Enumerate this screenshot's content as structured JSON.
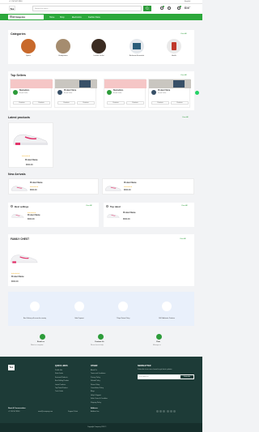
{
  "topbar": {
    "left_text": "+1 234 567 8900",
    "right_text": "English"
  },
  "header": {
    "logo": "Tex",
    "search_placeholder": "Search for items...",
    "cart_label": "My Cart",
    "cart_total": "$0.00",
    "wishlist_count": "0",
    "cart_count": "0"
  },
  "nav": {
    "categories_label": "All Categories",
    "links": [
      "Home",
      "Shop",
      "Electronics",
      "Fashion Store"
    ]
  },
  "categories": {
    "title": "Categories",
    "view_all": "View All",
    "items": [
      "Sports",
      "Headphones",
      "Leather Jacket",
      "Bathroom Essentials",
      "Health"
    ]
  },
  "top_sellers": {
    "title": "Top Sellers",
    "view_all": "View All",
    "cards": [
      {
        "name": "Bestsellers",
        "sub": "Brand Seller",
        "btn": "Products"
      },
      {
        "name": "Product Store",
        "sub": "Brand Seller",
        "btn": "Products"
      },
      {
        "name": "Bestsellers",
        "sub": "Brand Seller",
        "btn": "Products"
      },
      {
        "name": "Product Store",
        "sub": "Brand Seller",
        "btn": "Products"
      }
    ]
  },
  "latest_products": {
    "title": "Latest products",
    "view_all": "View All",
    "product": {
      "name": "Product Name",
      "price": "$500.00",
      "stars": "★★★★★"
    }
  },
  "new_arrivals": {
    "title": "New Arrivals",
    "items": [
      {
        "name": "Product Name",
        "price": "$500.00",
        "btn": "Add to Cart"
      },
      {
        "name": "Product Name",
        "price": "$500.00",
        "btn": "Add to Cart"
      }
    ]
  },
  "best_sellings": {
    "title": "Best sellings",
    "view_all": "View All",
    "product": {
      "name": "Product Name",
      "price": "$500.00",
      "stars": "★★★★★"
    }
  },
  "top_rated": {
    "title": "Top rated",
    "view_all": "View All",
    "product": {
      "name": "Product Name",
      "price": "$500.00",
      "stars": "★★★★★"
    }
  },
  "family_chest": {
    "title": "FAMILY CHEST",
    "view_all": "View All",
    "product": {
      "name": "Product Name",
      "price": "$500.00",
      "stars": "★★★★★"
    }
  },
  "features": [
    "Best Delivery all across the country",
    "Safe Payment",
    "7 Days Return Policy",
    "100% Authentic Products"
  ],
  "contact": [
    {
      "title": "Email us",
      "sub": "Write to us anytime"
    },
    {
      "title": "Contact Us",
      "sub": "We are here to help"
    },
    {
      "title": "Chat",
      "sub": "Message us"
    }
  ],
  "footer": {
    "logo": "Tex",
    "quick_links_title": "QUICK LINKS",
    "quick_links": [
      "Profile Info",
      "Flash Deals",
      "Featured Products",
      "Best Selling Product",
      "Latest Products",
      "Top Rated Product",
      "Track Order"
    ],
    "other_title": "OTHER",
    "other_links": [
      "About Us",
      "Terms and Conditions",
      "Privacy Policy",
      "Refund Policy",
      "Return Policy",
      "Cancellation Policy",
      "Blogs",
      "Help & Support",
      "Seller Terms & Condition",
      "Shipping Policy"
    ],
    "newsletter_title": "NEWSLETTER",
    "newsletter_text": "Subscribe to our new channel to get latest updates",
    "newsletter_placeholder": "Email Address",
    "subscribe_label": "Subscribe",
    "address_title": "Start A Conversation",
    "phone": "+1 234 567 8900",
    "email": "email@company.com",
    "support": "Support Ticket",
    "address_label": "Address",
    "address_value": "Address line",
    "copyright": "Copyright Company 2024 ©"
  }
}
